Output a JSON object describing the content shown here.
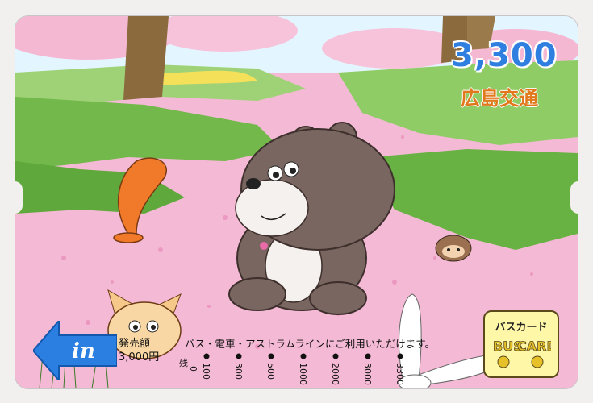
{
  "card": {
    "price": "3,300",
    "company": "広島交通",
    "issue_label": "発売額",
    "issue_amount": "3,000円",
    "notice": "バス・電車・アストラムラインにご利用いただけます。",
    "in_logo": "in",
    "bus_card_jp": "バスカード",
    "bus_card_en_1": "BUS",
    "bus_card_en_2": "CARD",
    "scale_numbers": [
      "100",
      "300",
      "500",
      "1000",
      "2000",
      "3000",
      "3300"
    ],
    "scale_zero": "0",
    "scale_marker": "残"
  },
  "colors": {
    "price": "#2f7fe0",
    "company": "#e1781c",
    "in_arrow": "#2b7fe0",
    "grass": "#6fb64a",
    "sky": "#dff4ff",
    "flowers": "#f3a6c9"
  }
}
